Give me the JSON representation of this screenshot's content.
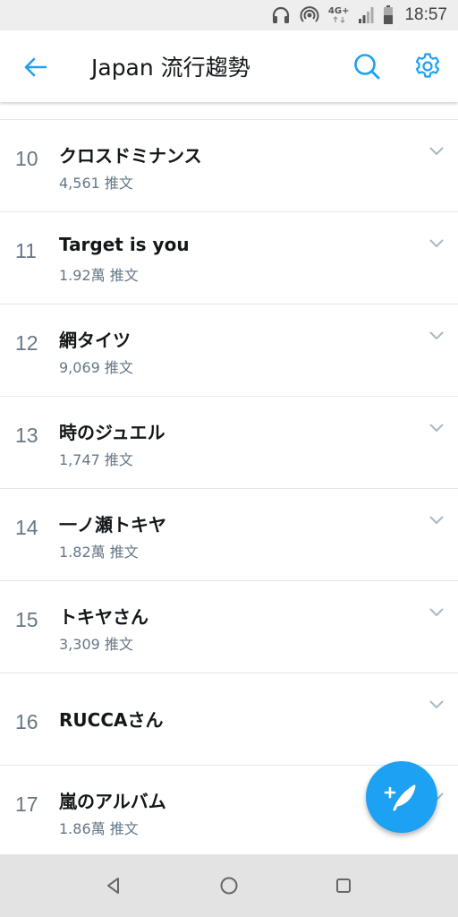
{
  "status_bar": {
    "icons": [
      "headphones-icon",
      "hotspot-icon",
      "network-type-icon",
      "signal-icon",
      "battery-icon"
    ],
    "network_type": "4G+",
    "time": "18:57"
  },
  "app_bar": {
    "title": "Japan 流行趨勢",
    "accent_color": "#1da1f2",
    "icons": [
      "back-arrow-icon",
      "search-icon",
      "gear-icon"
    ]
  },
  "trends": [
    {
      "rank": "10",
      "name": "クロスドミナンス",
      "count": "4,561 推文"
    },
    {
      "rank": "11",
      "name": "Target is you",
      "count": "1.92萬 推文"
    },
    {
      "rank": "12",
      "name": "網タイツ",
      "count": "9,069 推文"
    },
    {
      "rank": "13",
      "name": "時のジュエル",
      "count": "1,747 推文"
    },
    {
      "rank": "14",
      "name": "一ノ瀬トキヤ",
      "count": "1.82萬 推文"
    },
    {
      "rank": "15",
      "name": "トキヤさん",
      "count": "3,309 推文"
    },
    {
      "rank": "16",
      "name": "RUCCAさん",
      "count": ""
    },
    {
      "rank": "17",
      "name": "嵐のアルバム",
      "count": "1.86萬 推文"
    }
  ],
  "fab": {
    "icon": "compose-tweet-icon",
    "color": "#1da1f2"
  },
  "nav_bar": {
    "icons": [
      "back-triangle-icon",
      "home-circle-icon",
      "recents-square-icon"
    ]
  }
}
